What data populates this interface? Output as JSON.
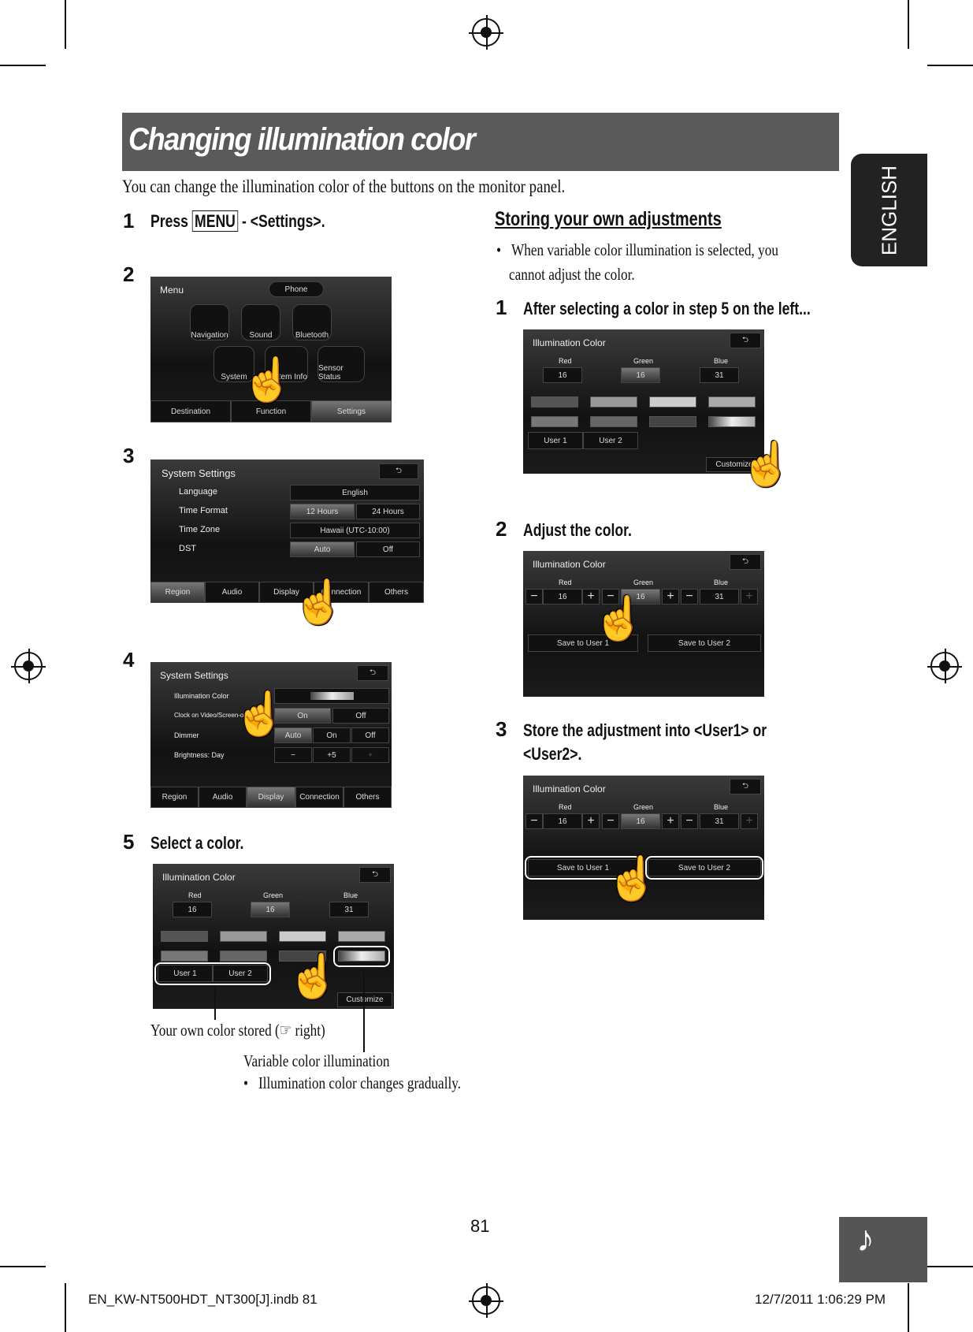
{
  "title": "Changing illumination color",
  "language_tab": "ENGLISH",
  "intro": "You can change the illumination color of the buttons on the monitor panel.",
  "left": {
    "step1": {
      "num": "1",
      "pre": "Press ",
      "key": "MENU",
      "post": " - <Settings>."
    },
    "step2": {
      "num": "2"
    },
    "step3": {
      "num": "3"
    },
    "step4": {
      "num": "4"
    },
    "step5": {
      "num": "5",
      "text": "Select a color."
    },
    "menu_screen": {
      "title": "Menu",
      "phone": "Phone",
      "items": [
        "Navigation",
        "Sound",
        "Bluetooth",
        "System",
        "System Info",
        "Sensor Status"
      ],
      "tabs": [
        "Destination",
        "Function",
        "Settings"
      ]
    },
    "sys_screen": {
      "title": "System Settings",
      "rows": [
        {
          "label": "Language",
          "values": [
            "English"
          ]
        },
        {
          "label": "Time Format",
          "values": [
            "12 Hours",
            "24 Hours"
          ]
        },
        {
          "label": "Time Zone",
          "values": [
            "Hawaii (UTC-10:00)"
          ]
        },
        {
          "label": "DST",
          "values": [
            "Auto",
            "Off"
          ]
        }
      ],
      "tabs": [
        "Region",
        "Audio",
        "Display",
        "Connection",
        "Others"
      ]
    },
    "display_screen": {
      "title": "System Settings",
      "rows": [
        {
          "label": "Illumination Color"
        },
        {
          "label": "Clock on Video/Screen-off",
          "values": [
            "On",
            "Off"
          ]
        },
        {
          "label": "Dimmer",
          "values": [
            "Auto",
            "On",
            "Off"
          ]
        },
        {
          "label": "Brightness: Day",
          "values": [
            "−",
            "+5",
            "+"
          ]
        }
      ],
      "tabs": [
        "Region",
        "Audio",
        "Display",
        "Connection",
        "Others"
      ]
    },
    "color_screen": {
      "title": "Illumination Color",
      "channels": [
        {
          "name": "Red",
          "value": "16"
        },
        {
          "name": "Green",
          "value": "16"
        },
        {
          "name": "Blue",
          "value": "31"
        }
      ],
      "user_buttons": [
        "User 1",
        "User 2"
      ],
      "customize": "Customize"
    },
    "caption_user": "Your own color stored (☞ right)",
    "caption_variable": "Variable color illumination",
    "caption_bullet": "Illumination color changes gradually."
  },
  "right": {
    "heading": "Storing your own adjustments",
    "note_line1": "When variable color illumination is selected, you",
    "note_line2": "cannot adjust the color.",
    "step1": {
      "num": "1",
      "text": "After selecting a color in step 5 on the left..."
    },
    "step2": {
      "num": "2",
      "text": "Adjust the color."
    },
    "step3": {
      "num": "3",
      "line1": "Store the adjustment into <User1> or",
      "line2": "<User2>."
    },
    "save_buttons": [
      "Save to User 1",
      "Save to User 2"
    ]
  },
  "page_number": "81",
  "footer": {
    "file": "EN_KW-NT500HDT_NT300[J].indb   81",
    "date": "12/7/2011   1:06:29 PM"
  },
  "colors": {
    "title_bar": "#5a5a5a",
    "tab": "#222222"
  }
}
